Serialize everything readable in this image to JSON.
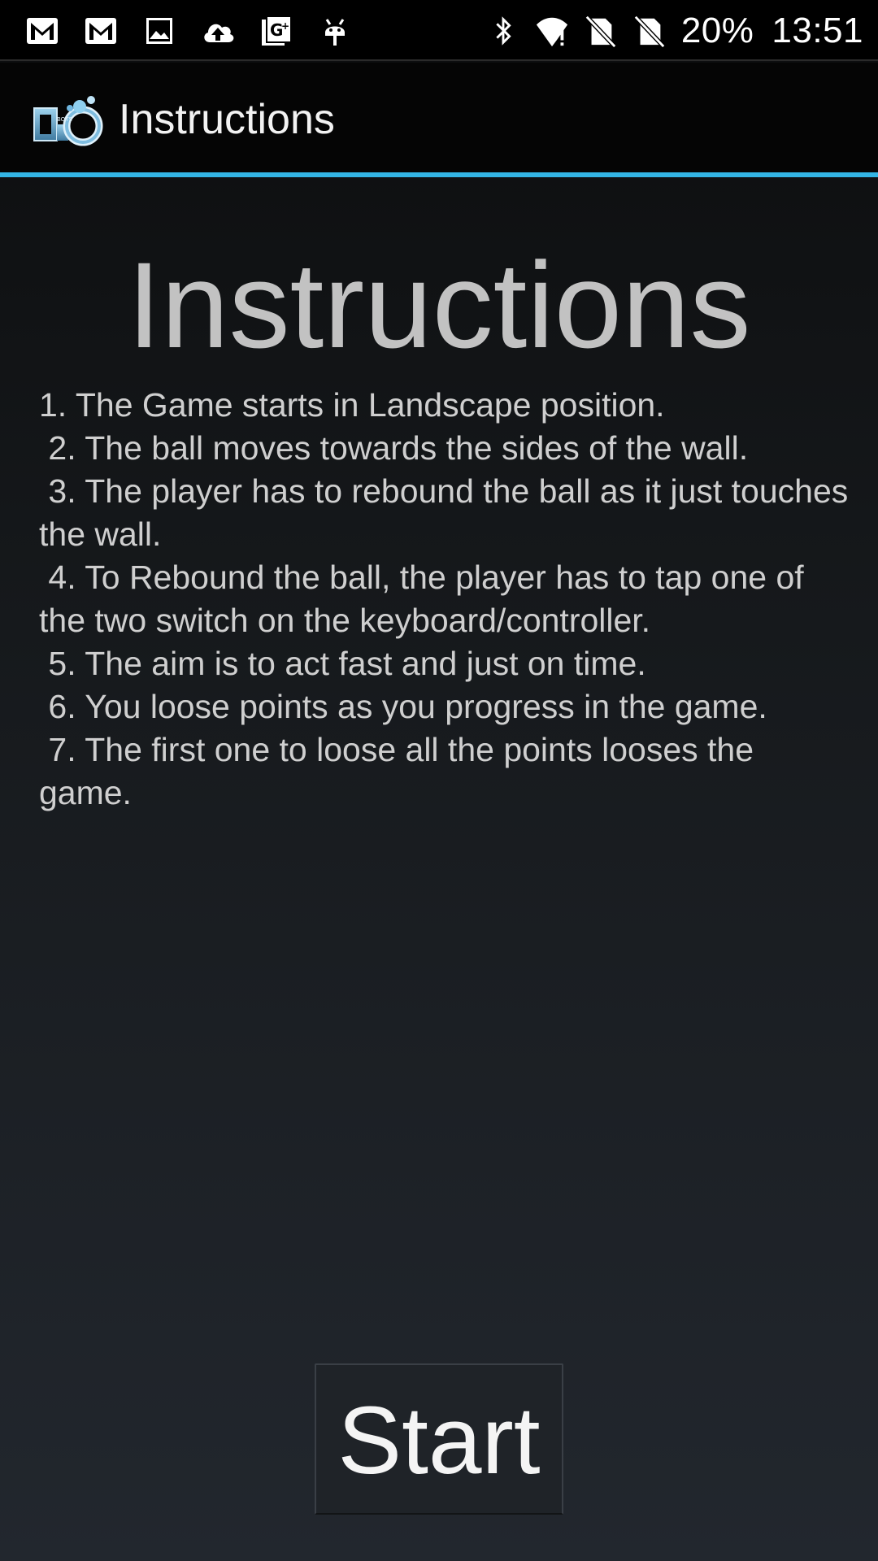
{
  "status_bar": {
    "left_icons": [
      "gmail-icon",
      "gmail-icon",
      "gallery-icon",
      "cloud-upload-icon",
      "google-plus-icon",
      "android-debug-icon"
    ],
    "right_icons": [
      "bluetooth-icon",
      "wifi-alert-icon",
      "no-sim-icon",
      "no-sim-icon"
    ],
    "battery": "20%",
    "time": "13:51"
  },
  "action_bar": {
    "title": "Instructions",
    "logo_icon": "app-logo-icon",
    "divider_color": "#33b5e5"
  },
  "main": {
    "heading": "Instructions",
    "instructions_text": "1. The Game starts in Landscape position.\n 2. The ball moves towards the sides of the wall.\n 3. The player has to rebound the ball as it just touches the wall.\n 4. To Rebound the ball, the player has to tap one of the two switch on the keyboard/controller.\n 5. The aim is to act fast and just on time.\n 6. You loose points as you progress in the game.\n 7. The first one to loose all the points looses the game.",
    "start_label": "Start"
  }
}
